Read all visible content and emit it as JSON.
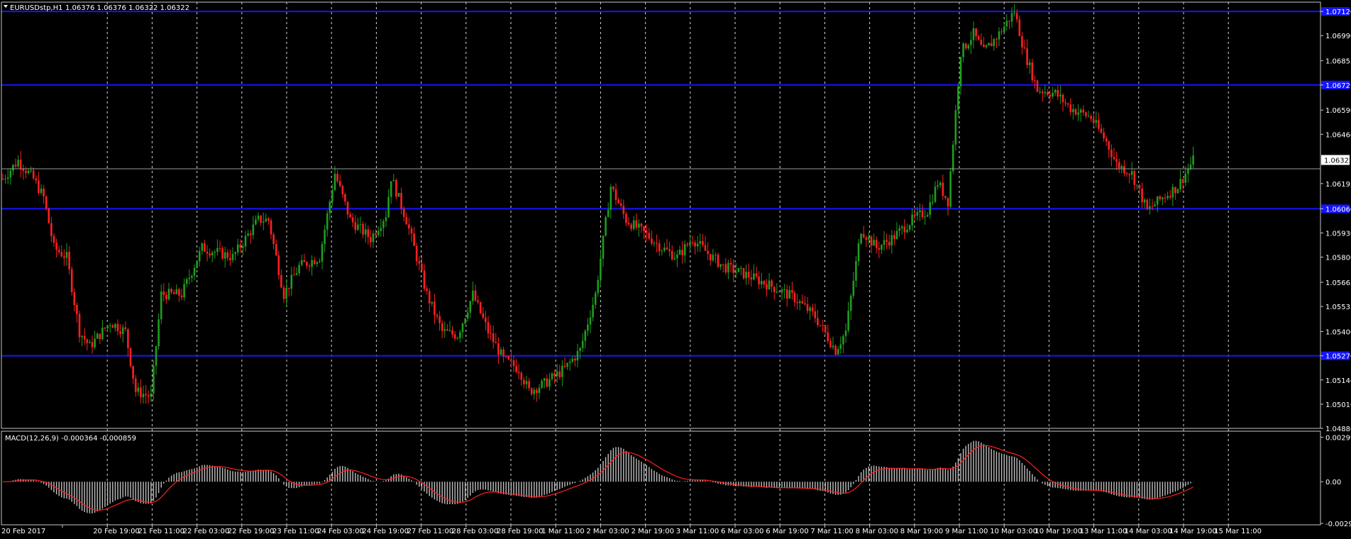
{
  "window": {
    "symbol_title": "EURUSDstp,H1",
    "ohlc": "1.06376 1.06376 1.06322 1.06322",
    "macd_title": "MACD(12,26,9) -0.000364 -0.000859"
  },
  "colors": {
    "background": "#000000",
    "bull_candle": "#1f9d1f",
    "bear_candle": "#ff2020",
    "level_line": "#1515ff",
    "grid": "#ffffff",
    "macd_hist": "#c0c0c0",
    "macd_signal": "#ff2020"
  },
  "chart_data": [
    {
      "type": "candlestick",
      "timeframe": "H1",
      "ylim": [
        1.0488,
        1.0717
      ],
      "price_ticks": [
        "1.07120",
        "1.06990",
        "1.06855",
        "1.06725",
        "1.06590",
        "1.06460",
        "1.06322",
        "1.06195",
        "1.06060",
        "1.05930",
        "1.05800",
        "1.05665",
        "1.05535",
        "1.05400",
        "1.05270",
        "1.05140",
        "1.05010",
        "1.04880"
      ],
      "current_price": "1.06322",
      "horizontal_levels": [
        1.0712,
        1.06725,
        1.0606,
        1.0527
      ],
      "x_labels": [
        "20 Feb 2017",
        "20 Feb 19:00",
        "21 Feb 11:00",
        "22 Feb 03:00",
        "22 Feb 19:00",
        "23 Feb 11:00",
        "24 Feb 03:00",
        "24 Feb 19:00",
        "27 Feb 11:00",
        "28 Feb 03:00",
        "28 Feb 19:00",
        "1 Mar 11:00",
        "2 Mar 03:00",
        "2 Mar 19:00",
        "3 Mar 11:00",
        "6 Mar 03:00",
        "6 Mar 19:00",
        "7 Mar 11:00",
        "8 Mar 03:00",
        "8 Mar 19:00",
        "9 Mar 11:00",
        "10 Mar 03:00",
        "10 Mar 19:00",
        "13 Mar 11:00",
        "14 Mar 03:00",
        "14 Mar 19:00",
        "15 Mar 11:00"
      ],
      "key_points": [
        [
          0,
          1.0622
        ],
        [
          6,
          1.0632
        ],
        [
          12,
          1.0622
        ],
        [
          16,
          1.0612
        ],
        [
          20,
          1.0585
        ],
        [
          25,
          1.058
        ],
        [
          30,
          1.054
        ],
        [
          34,
          1.0532
        ],
        [
          42,
          1.0545
        ],
        [
          48,
          1.054
        ],
        [
          52,
          1.0508
        ],
        [
          58,
          1.0505
        ],
        [
          62,
          1.056
        ],
        [
          70,
          1.056
        ],
        [
          78,
          1.0585
        ],
        [
          90,
          1.058
        ],
        [
          100,
          1.06
        ],
        [
          104,
          1.06
        ],
        [
          110,
          1.056
        ],
        [
          116,
          1.0575
        ],
        [
          124,
          1.058
        ],
        [
          130,
          1.0625
        ],
        [
          136,
          1.06
        ],
        [
          144,
          1.059
        ],
        [
          150,
          1.0603
        ],
        [
          152,
          1.0623
        ],
        [
          158,
          1.06
        ],
        [
          166,
          1.056
        ],
        [
          172,
          1.054
        ],
        [
          178,
          1.0538
        ],
        [
          184,
          1.056
        ],
        [
          190,
          1.054
        ],
        [
          196,
          1.0525
        ],
        [
          202,
          1.052
        ],
        [
          206,
          1.0508
        ],
        [
          212,
          1.0512
        ],
        [
          220,
          1.052
        ],
        [
          226,
          1.053
        ],
        [
          232,
          1.056
        ],
        [
          238,
          1.0618
        ],
        [
          244,
          1.06
        ],
        [
          252,
          1.0592
        ],
        [
          258,
          1.0585
        ],
        [
          264,
          1.058
        ],
        [
          270,
          1.059
        ],
        [
          276,
          1.0582
        ],
        [
          282,
          1.0575
        ],
        [
          292,
          1.057
        ],
        [
          300,
          1.0565
        ],
        [
          310,
          1.0558
        ],
        [
          318,
          1.0548
        ],
        [
          326,
          1.053
        ],
        [
          330,
          1.054
        ],
        [
          336,
          1.0595
        ],
        [
          342,
          1.0585
        ],
        [
          348,
          1.059
        ],
        [
          356,
          1.06
        ],
        [
          362,
          1.0605
        ],
        [
          366,
          1.062
        ],
        [
          370,
          1.061
        ],
        [
          375,
          1.069
        ],
        [
          380,
          1.07
        ],
        [
          384,
          1.069
        ],
        [
          390,
          1.07
        ],
        [
          396,
          1.0712
        ],
        [
          400,
          1.069
        ],
        [
          405,
          1.067
        ],
        [
          412,
          1.0668
        ],
        [
          418,
          1.066
        ],
        [
          426,
          1.0655
        ],
        [
          432,
          1.0642
        ],
        [
          436,
          1.063
        ],
        [
          442,
          1.0625
        ],
        [
          448,
          1.0605
        ],
        [
          454,
          1.0612
        ],
        [
          460,
          1.0618
        ],
        [
          466,
          1.0632
        ]
      ]
    },
    {
      "type": "bar",
      "title": "MACD(12,26,9)",
      "main_value": -0.000364,
      "signal_value": -0.000859,
      "ylim": [
        -0.0029,
        0.0034
      ],
      "y_ticks": [
        "0.002996",
        "0.00",
        "-0.0029"
      ]
    }
  ]
}
